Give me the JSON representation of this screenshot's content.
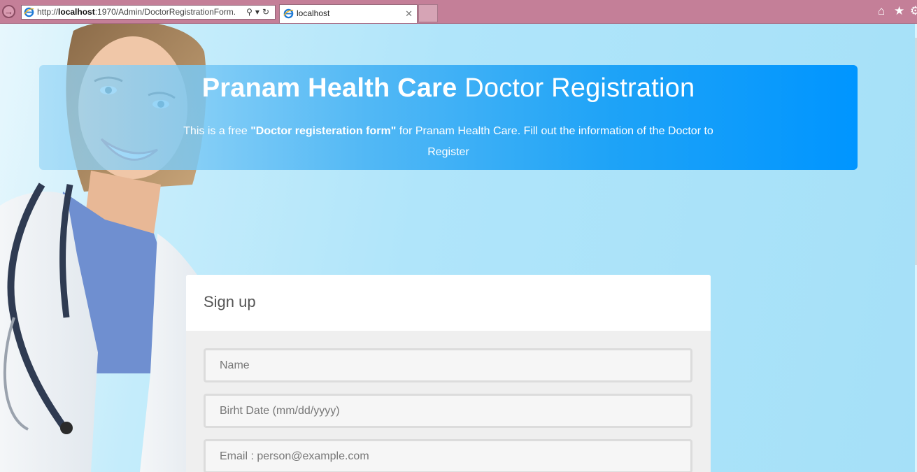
{
  "browser": {
    "url_prefix": "http://",
    "url_host": "localhost",
    "url_rest": ":1970/Admin/DoctorRegistrationForm.",
    "tab_title": "localhost",
    "icons": [
      "back-arrow-icon",
      "ie-icon",
      "search-icon",
      "dropdown-icon",
      "refresh-icon",
      "close-icon",
      "home-icon",
      "star-icon",
      "gear-icon"
    ]
  },
  "hero": {
    "brand": "Pranam Health Care",
    "title_rest": "Doctor Registration",
    "desc_before": "This is a free ",
    "desc_bold": "\"Doctor registeration form\"",
    "desc_after": " for Pranam Health Care. Fill out the information of the Doctor to Register"
  },
  "form": {
    "heading": "Sign up",
    "name_placeholder": "Name",
    "birth_placeholder": "Birht Date (mm/dd/yyyy)",
    "email_placeholder": "Email : person@example.com"
  },
  "colors": {
    "chrome": "#c47f98",
    "hero_end": "#0095ff",
    "page_bg": "#a9e2f7"
  }
}
